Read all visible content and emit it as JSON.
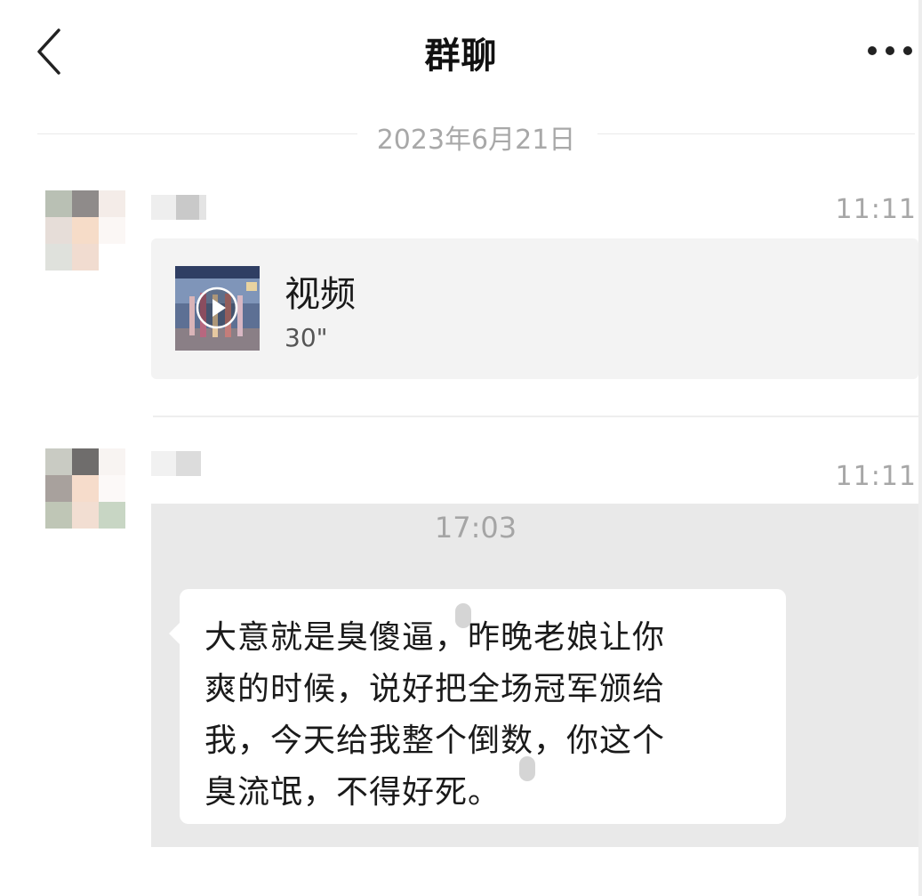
{
  "header": {
    "title": "群聊",
    "back_icon": "chevron-left-icon",
    "more_icon": "more-dots-icon"
  },
  "date_divider": "2023年6月21日",
  "messages": [
    {
      "time": "11:11",
      "video": {
        "title": "视频",
        "duration": "30\"",
        "icon": "play-icon"
      }
    },
    {
      "time": "11:11",
      "screenshot": {
        "time": "17:03",
        "lines": [
          "大意就是臭傻逼，昨晚老娘让你",
          "爽的时候，说好把全场冠军颁给",
          "我，今天给我整个倒数，你这个",
          "臭流氓，不得好死。"
        ]
      }
    }
  ],
  "colors": {
    "background": "#ffffff",
    "card": "#f3f3f3",
    "image_bg": "#e9e9e9",
    "muted_text": "#a8a8a8"
  }
}
